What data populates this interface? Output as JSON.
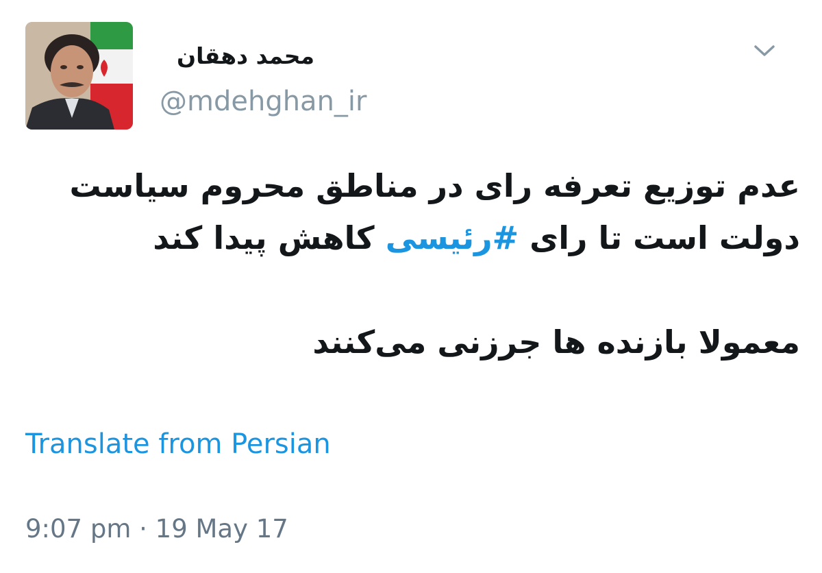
{
  "author": {
    "display_name": "محمد دهقان",
    "handle": "@mdehghan_ir"
  },
  "icons": {
    "menu": "chevron-down-icon",
    "avatar": "profile-photo"
  },
  "tweet": {
    "line1": "عدم توزیع تعرفه رای در مناطق محروم سیاست",
    "line2_before": "دولت است تا رای ",
    "hashtag": "#رئیسی",
    "line2_after": " کاهش پیدا کند",
    "line3": "معمولا بازنده ها جرزنی می‌کنند"
  },
  "translate_label": "Translate from Persian",
  "timestamp": "9:07 pm · 19 May 17",
  "colors": {
    "link": "#1b95e0",
    "secondary_text": "#8899a6",
    "primary_text": "#14171a"
  }
}
